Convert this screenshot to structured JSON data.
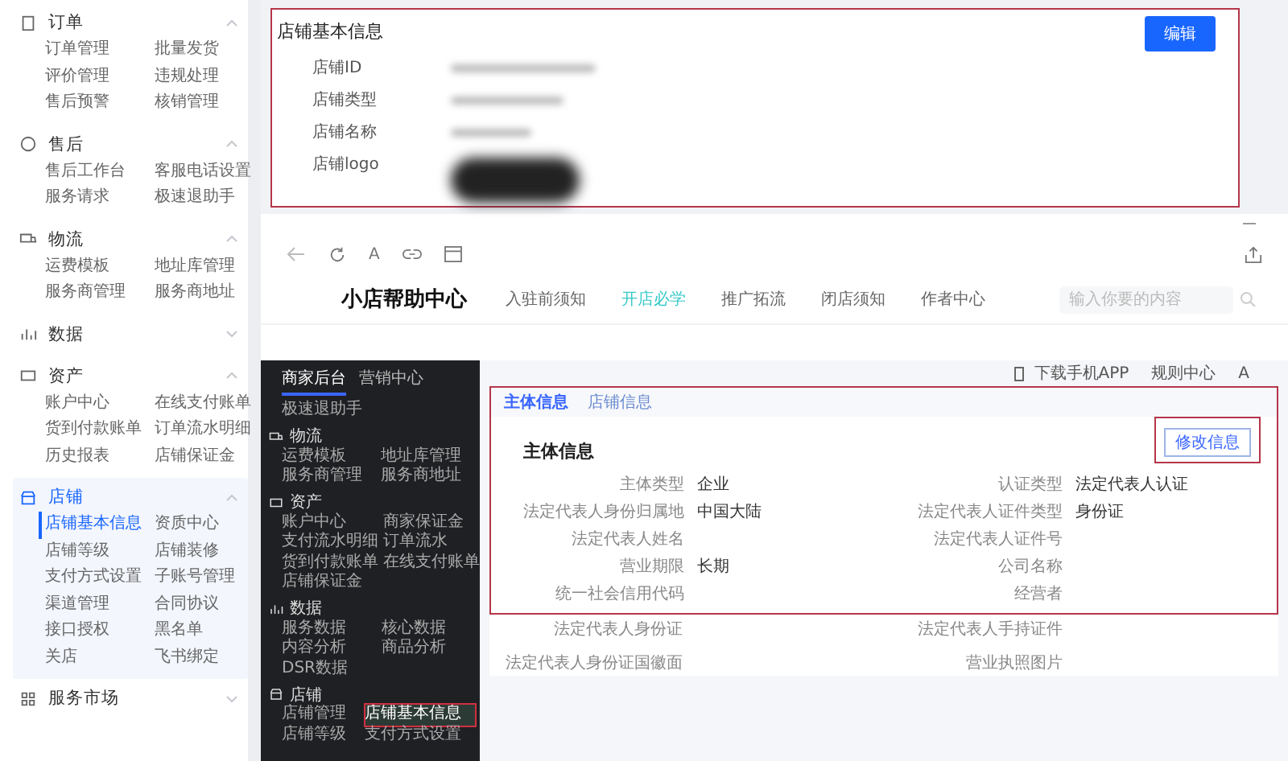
{
  "sidebar": {
    "sections": [
      {
        "title": "订单",
        "kind": "order",
        "expanded": true,
        "selected": false,
        "items": [
          {
            "label": "订单管理",
            "selected": false
          },
          {
            "label": "批量发货",
            "selected": false
          },
          {
            "label": "评价管理",
            "selected": false
          },
          {
            "label": "违规处理",
            "selected": false
          },
          {
            "label": "售后预警",
            "selected": false
          },
          {
            "label": "核销管理",
            "selected": false
          }
        ]
      },
      {
        "title": "售后",
        "kind": "aftersale",
        "expanded": true,
        "selected": false,
        "items": [
          {
            "label": "售后工作台",
            "selected": false
          },
          {
            "label": "客服电话设置",
            "selected": false
          },
          {
            "label": "服务请求",
            "selected": false
          },
          {
            "label": "极速退助手",
            "selected": false
          }
        ]
      },
      {
        "title": "物流",
        "kind": "logistics",
        "expanded": true,
        "selected": false,
        "items": [
          {
            "label": "运费模板",
            "selected": false
          },
          {
            "label": "地址库管理",
            "selected": false
          },
          {
            "label": "服务商管理",
            "selected": false
          },
          {
            "label": "服务商地址",
            "selected": false
          }
        ]
      },
      {
        "title": "数据",
        "kind": "data",
        "expanded": false,
        "selected": false
      },
      {
        "title": "资产",
        "kind": "asset",
        "expanded": true,
        "selected": false,
        "items": [
          {
            "label": "账户中心",
            "selected": false
          },
          {
            "label": "在线支付账单",
            "selected": false
          },
          {
            "label": "货到付款账单",
            "selected": false
          },
          {
            "label": "订单流水明细",
            "selected": false
          },
          {
            "label": "历史报表",
            "selected": false
          },
          {
            "label": "店铺保证金",
            "selected": false
          }
        ]
      },
      {
        "title": "店铺",
        "kind": "shop",
        "expanded": true,
        "selected": true,
        "items": [
          {
            "label": "店铺基本信息",
            "selected": true
          },
          {
            "label": "资质中心",
            "selected": false
          },
          {
            "label": "店铺等级",
            "selected": false
          },
          {
            "label": "店铺装修",
            "selected": false
          },
          {
            "label": "支付方式设置",
            "selected": false
          },
          {
            "label": "子账号管理",
            "selected": false
          },
          {
            "label": "渠道管理",
            "selected": false
          },
          {
            "label": "合同协议",
            "selected": false
          },
          {
            "label": "接口授权",
            "selected": false
          },
          {
            "label": "黑名单",
            "selected": false
          },
          {
            "label": "关店",
            "selected": false
          },
          {
            "label": "飞书绑定",
            "selected": false
          }
        ]
      },
      {
        "title": "服务市场",
        "kind": "market",
        "expanded": false,
        "selected": false
      }
    ]
  },
  "shop_info": {
    "title": "店铺基本信息",
    "edit_button": "编辑",
    "fields": [
      {
        "label": "店铺ID",
        "kind": "text"
      },
      {
        "label": "店铺类型",
        "kind": "text"
      },
      {
        "label": "店铺名称",
        "kind": "text"
      },
      {
        "label": "店铺logo",
        "kind": "image"
      }
    ]
  },
  "browser": {
    "toolbar": {
      "reader_label": "A"
    },
    "nav": {
      "site_title": "小店帮助中心",
      "tabs": [
        {
          "label": "入驻前须知",
          "selected": false
        },
        {
          "label": "开店必学",
          "selected": true
        },
        {
          "label": "推广拓流",
          "selected": false
        },
        {
          "label": "闭店须知",
          "selected": false
        },
        {
          "label": "作者中心",
          "selected": false
        }
      ],
      "search": {
        "placeholder": "输入你要的内容"
      }
    },
    "backend": {
      "tabs": [
        {
          "label": "商家后台",
          "selected": true
        },
        {
          "label": "营销中心",
          "selected": false
        }
      ],
      "top_item": "极速退助手",
      "sections": [
        {
          "title": "物流",
          "kind": "logistics",
          "items": [
            {
              "label": "运费模板",
              "selected": false
            },
            {
              "label": "地址库管理",
              "selected": false
            },
            {
              "label": "服务商管理",
              "selected": false
            },
            {
              "label": "服务商地址",
              "selected": false
            }
          ]
        },
        {
          "title": "资产",
          "kind": "asset",
          "items": [
            {
              "label": "账户中心",
              "selected": false
            },
            {
              "label": "商家保证金",
              "selected": false
            },
            {
              "label": "支付流水明细",
              "selected": false
            },
            {
              "label": "订单流水",
              "selected": false
            },
            {
              "label": "货到付款账单",
              "selected": false
            },
            {
              "label": "在线支付账单",
              "selected": false
            },
            {
              "label": "店铺保证金",
              "selected": false
            }
          ]
        },
        {
          "title": "数据",
          "kind": "data",
          "items": [
            {
              "label": "服务数据",
              "selected": false
            },
            {
              "label": "核心数据",
              "selected": false
            },
            {
              "label": "内容分析",
              "selected": false
            },
            {
              "label": "商品分析",
              "selected": false
            },
            {
              "label": "DSR数据",
              "selected": false
            }
          ]
        },
        {
          "title": "店铺",
          "kind": "shop",
          "items": [
            {
              "label": "店铺管理",
              "selected": false
            },
            {
              "label": "店铺基本信息",
              "selected": true
            },
            {
              "label": "店铺等级",
              "selected": false
            },
            {
              "label": "支付方式设置",
              "selected": false
            }
          ]
        }
      ]
    },
    "header_links": [
      {
        "label": "下载手机APP",
        "kind": "phone"
      },
      {
        "label": "规则中心",
        "kind": "text"
      },
      {
        "label": "A",
        "kind": "text"
      }
    ],
    "content": {
      "tabs": [
        {
          "label": "主体信息",
          "selected": true
        },
        {
          "label": "店铺信息",
          "selected": false
        }
      ],
      "button": "修改信息",
      "heading": "主体信息",
      "fields": [
        {
          "label": "主体类型",
          "value": "企业"
        },
        {
          "label": "认证类型",
          "value": "法定代表人认证"
        },
        {
          "label": "法定代表人身份归属地",
          "value": "中国大陆"
        },
        {
          "label": "法定代表人证件类型",
          "value": "身份证"
        },
        {
          "label": "法定代表人姓名"
        },
        {
          "label": "法定代表人证件号"
        },
        {
          "label": "营业期限",
          "value": "长期"
        },
        {
          "label": "公司名称"
        },
        {
          "label": "统一社会信用代码"
        },
        {
          "label": "经营者"
        }
      ],
      "extra_fields": [
        {
          "label": "法定代表人身份证"
        },
        {
          "label": "法定代表人手持证件"
        },
        {
          "label": "法定代表人身份证国徽面"
        },
        {
          "label": "营业执照图片"
        }
      ]
    }
  }
}
